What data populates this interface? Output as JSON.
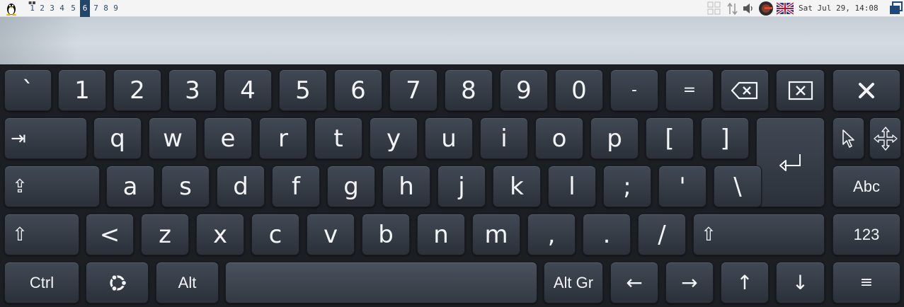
{
  "taskbar": {
    "workspaces": [
      "1",
      "2",
      "3",
      "4",
      "5",
      "6",
      "7",
      "8",
      "9"
    ],
    "active_workspace": "6",
    "clock": "Sat Jul 29, 14:08",
    "icons": [
      "tux-icon",
      "workspace-grid-icon",
      "network-icon",
      "volume-icon",
      "user-avatar-icon",
      "uk-flag-icon",
      "window-icon"
    ]
  },
  "keyboard": {
    "row1": [
      "`",
      "1",
      "2",
      "3",
      "4",
      "5",
      "6",
      "7",
      "8",
      "9",
      "0",
      "-",
      "="
    ],
    "row2": [
      "q",
      "w",
      "e",
      "r",
      "t",
      "y",
      "u",
      "i",
      "o",
      "p",
      "[",
      "]"
    ],
    "row3": [
      "a",
      "s",
      "d",
      "f",
      "g",
      "h",
      "j",
      "k",
      "l",
      ";",
      "'",
      "\\"
    ],
    "row4": [
      "<",
      "z",
      "x",
      "c",
      "v",
      "b",
      "n",
      "m",
      ",",
      ".",
      "/"
    ],
    "labels": {
      "ctrl": "Ctrl",
      "alt": "Alt",
      "altgr": "Alt Gr",
      "abc": "Abc",
      "num": "123",
      "tab": "⇥",
      "shift_left": "⇧",
      "shift_right": "⇧",
      "caps": "⇪",
      "left": "←",
      "right": "→",
      "up": "↑",
      "down": "↓",
      "menu": "≡"
    },
    "icons": [
      "backspace-icon",
      "delete-icon",
      "close-icon",
      "pointer-icon",
      "move-icon",
      "enter-icon",
      "ubuntu-icon"
    ]
  }
}
